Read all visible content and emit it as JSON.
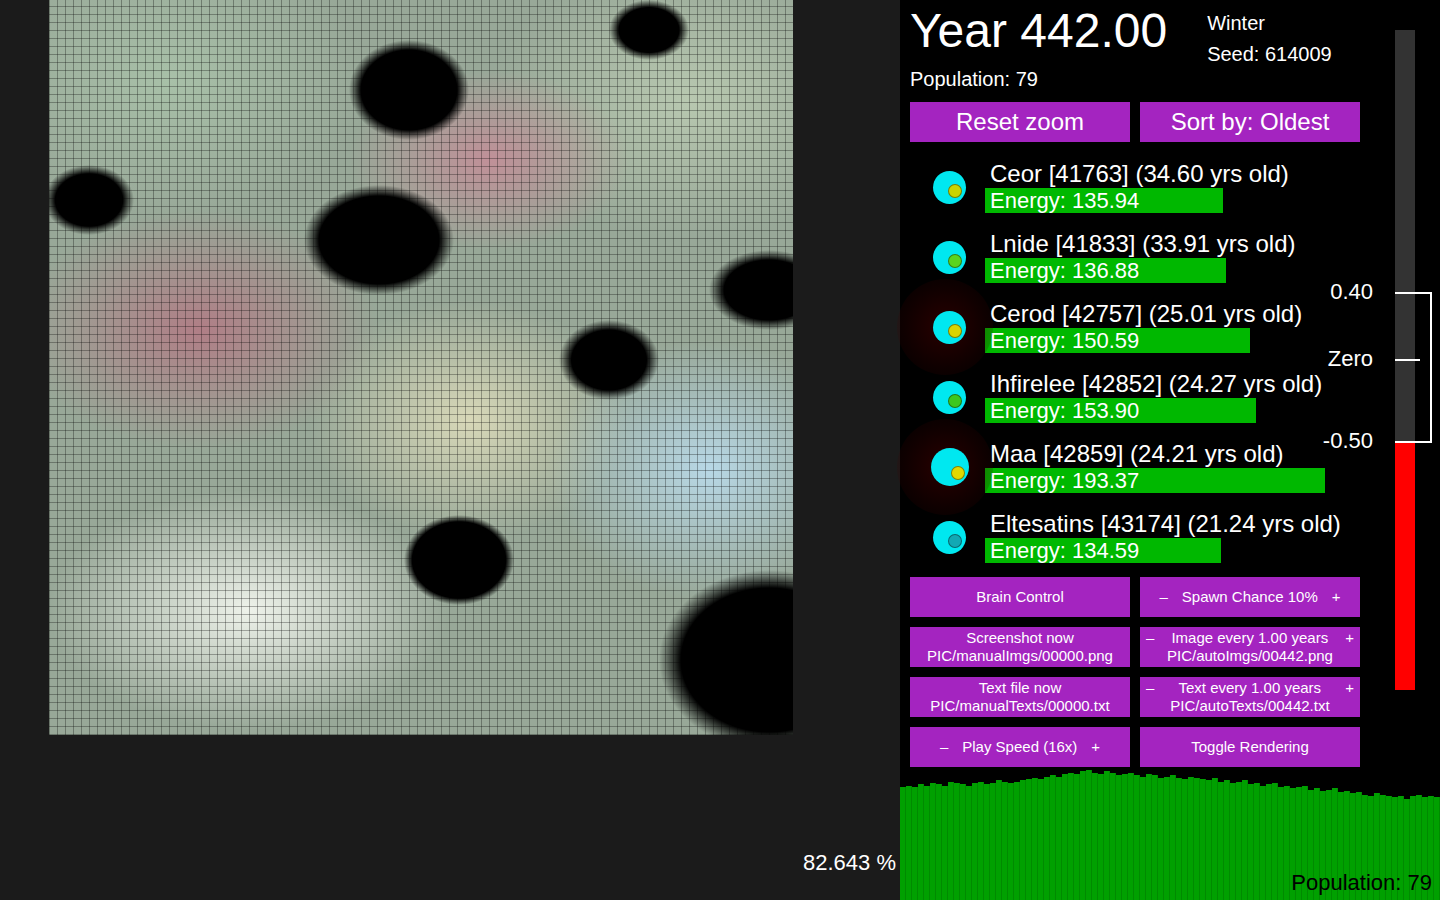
{
  "header": {
    "year": "Year 442.00",
    "season": "Winter",
    "seed": "Seed: 614009",
    "population": "Population: 79"
  },
  "top_buttons": [
    "Reset zoom",
    "Sort by: Oldest"
  ],
  "creatures": [
    {
      "name": "Ceor [41763] (34.60 yrs old)",
      "energy": "Energy: 135.94",
      "level": 0.635,
      "color": "#c8d400",
      "glow": false
    },
    {
      "name": "Lnide [41833] (33.91 yrs old)",
      "energy": "Energy: 136.88",
      "level": 0.643,
      "color": "#5ad41e",
      "glow": false
    },
    {
      "name": "Cerod [42757] (25.01 yrs old)",
      "energy": "Energy: 150.59",
      "level": 0.707,
      "color": "#d8d400",
      "glow": true
    },
    {
      "name": "Ihfirelee [42852] (24.27 yrs old)",
      "energy": "Energy: 153.90",
      "level": 0.723,
      "color": "#3cc81e",
      "glow": false
    },
    {
      "name": "Maa [42859] (24.21 yrs old)",
      "energy": "Energy: 193.37",
      "level": 0.907,
      "color": "#e0d800",
      "glow": true
    },
    {
      "name": "Eltesatins [43174] (21.24 yrs old)",
      "energy": "Energy: 134.59",
      "level": 0.629,
      "color": "#12a8b4",
      "glow": false
    }
  ],
  "controls": [
    {
      "label": "Brain Control",
      "minus": "",
      "plus": "",
      "sub": ""
    },
    {
      "label": "Spawn Chance 10%",
      "minus": "–",
      "plus": "+",
      "sub": ""
    },
    {
      "label": "Screenshot now",
      "minus": "",
      "plus": "",
      "sub": "PIC/manualImgs/00000.png"
    },
    {
      "label": "Image every 1.00 years",
      "minus": "–",
      "plus": "+",
      "sub": "PIC/autoImgs/00442.png"
    },
    {
      "label": "Text file now",
      "minus": "",
      "plus": "",
      "sub": "PIC/manualTexts/00000.txt"
    },
    {
      "label": "Text every 1.00 years",
      "minus": "–",
      "plus": "+",
      "sub": "PIC/autoTexts/00442.txt"
    },
    {
      "label": "Play Speed (16x)",
      "minus": "–",
      "plus": "+",
      "sub": ""
    },
    {
      "label": "Toggle Rendering",
      "minus": "",
      "plus": "",
      "sub": ""
    }
  ],
  "gauge": {
    "level": 0.376,
    "markers": [
      {
        "label": "0.40",
        "level": 0.601
      },
      {
        "label": "Zero",
        "level": 0.5
      },
      {
        "label": "-0.50",
        "level": 0.376
      }
    ]
  },
  "map": {
    "zoom": "82.643 %"
  },
  "chart": {
    "label": "Population: 79",
    "max": 100,
    "values": [
      87,
      88,
      87,
      89,
      88,
      90,
      89,
      88,
      91,
      90,
      89,
      88,
      90,
      91,
      89,
      90,
      92,
      91,
      90,
      91,
      92,
      93,
      94,
      93,
      95,
      96,
      95,
      97,
      98,
      97,
      99,
      100,
      98,
      97,
      99,
      98,
      96,
      97,
      98,
      96,
      95,
      97,
      96,
      94,
      95,
      96,
      94,
      93,
      95,
      94,
      93,
      92,
      94,
      91,
      92,
      90,
      91,
      92,
      89,
      90,
      88,
      89,
      90,
      87,
      88,
      86,
      87,
      88,
      85,
      86,
      84,
      85,
      86,
      83,
      84,
      82,
      83,
      81,
      80,
      82,
      81,
      80,
      79,
      80,
      78,
      80,
      81,
      79,
      80,
      79
    ]
  }
}
